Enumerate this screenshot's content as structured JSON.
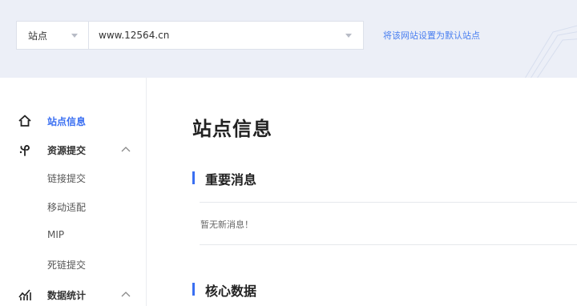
{
  "header": {
    "site_select_label": "站点",
    "url_value": "www.12564.cn",
    "set_default_link": "将该网站设置为默认站点"
  },
  "sidebar": {
    "site_info": "站点信息",
    "resource_submit": "资源提交",
    "sub_items": [
      "链接提交",
      "移动适配",
      "MIP",
      "死链提交"
    ],
    "data_stats": "数据统计"
  },
  "main": {
    "page_title": "站点信息",
    "important_news_title": "重要消息",
    "no_news": "暂无新消息！",
    "core_data_title": "核心数据"
  },
  "colors": {
    "accent": "#3a6ff2",
    "link": "#4a7ff0",
    "header_bg": "#eceff7"
  },
  "icons": [
    "home-icon",
    "resource-icon",
    "chevron-up-icon",
    "stats-icon",
    "chevron-down-icon"
  ]
}
